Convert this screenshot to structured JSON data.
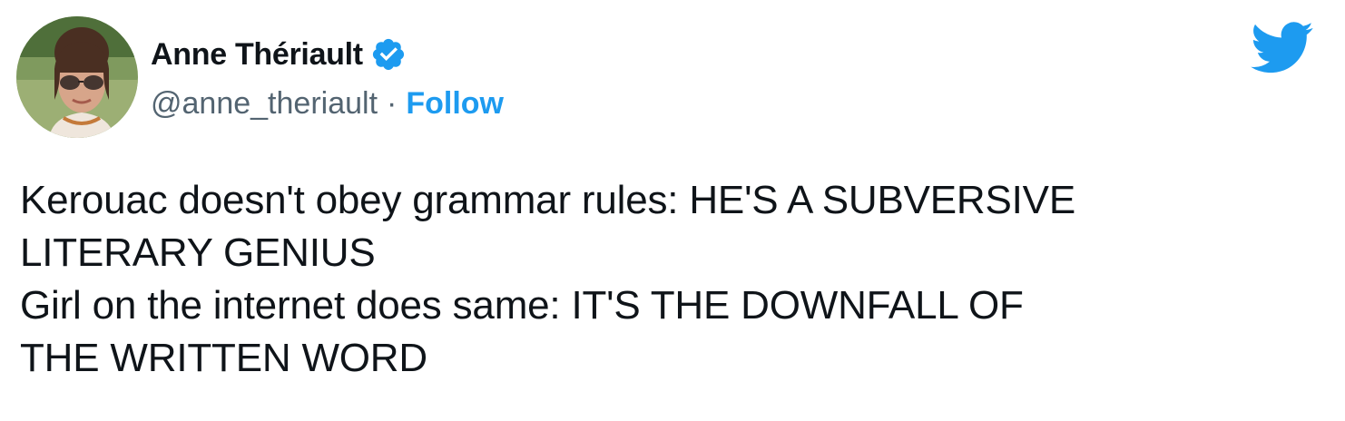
{
  "author": {
    "display_name": "Anne Thériault",
    "handle": "@anne_theriault",
    "separator": "·",
    "follow_label": "Follow",
    "verified": true
  },
  "icons": {
    "verified": "verified-badge-icon",
    "platform": "twitter-bird-icon"
  },
  "tweet": {
    "lines": [
      "Kerouac doesn't obey grammar rules: HE'S A SUBVERSIVE",
      "LITERARY GENIUS",
      "Girl on the internet does same: IT'S THE DOWNFALL OF",
      "THE WRITTEN WORD"
    ]
  },
  "colors": {
    "accent": "#1d9bf0",
    "text": "#0f1419",
    "secondary": "#536471"
  }
}
